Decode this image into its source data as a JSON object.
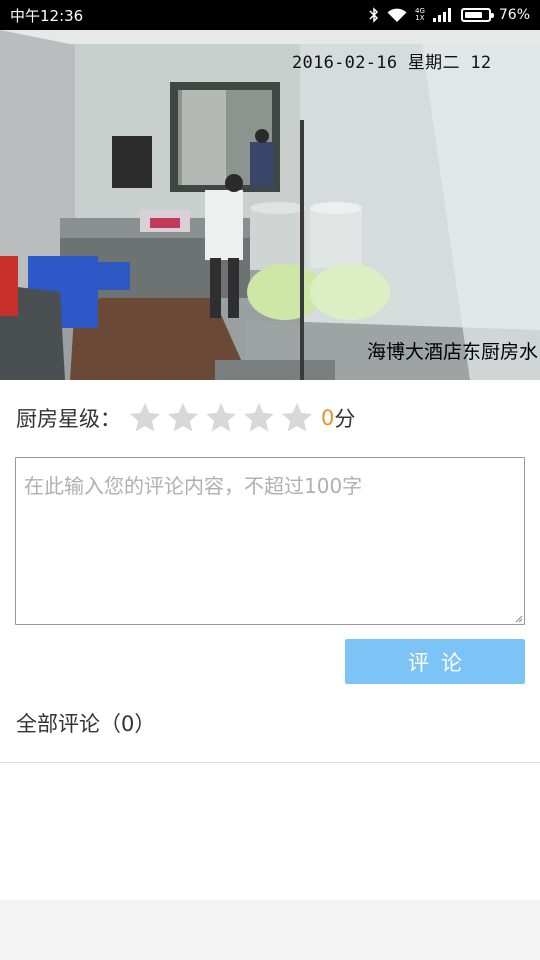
{
  "status_bar": {
    "time": "中午12:36",
    "network_label_top": "4G",
    "network_label_bottom": "1X",
    "battery_percent": "76%",
    "battery_level": 0.76
  },
  "video": {
    "timestamp": "2016-02-16  星期二  12",
    "camera_label": "海博大酒店东厨房水"
  },
  "rating": {
    "label": "厨房星级：",
    "stars_total": 5,
    "stars_filled": 0,
    "score": "0",
    "score_unit": "分",
    "star_color_empty": "#d8d8d8",
    "score_color": "#e8922a"
  },
  "comment": {
    "placeholder": "在此输入您的评论内容，不超过100字",
    "value": ""
  },
  "submit_button": {
    "label": "评论",
    "color": "#7cc4f6"
  },
  "comments_section": {
    "title": "全部评论（0）"
  }
}
